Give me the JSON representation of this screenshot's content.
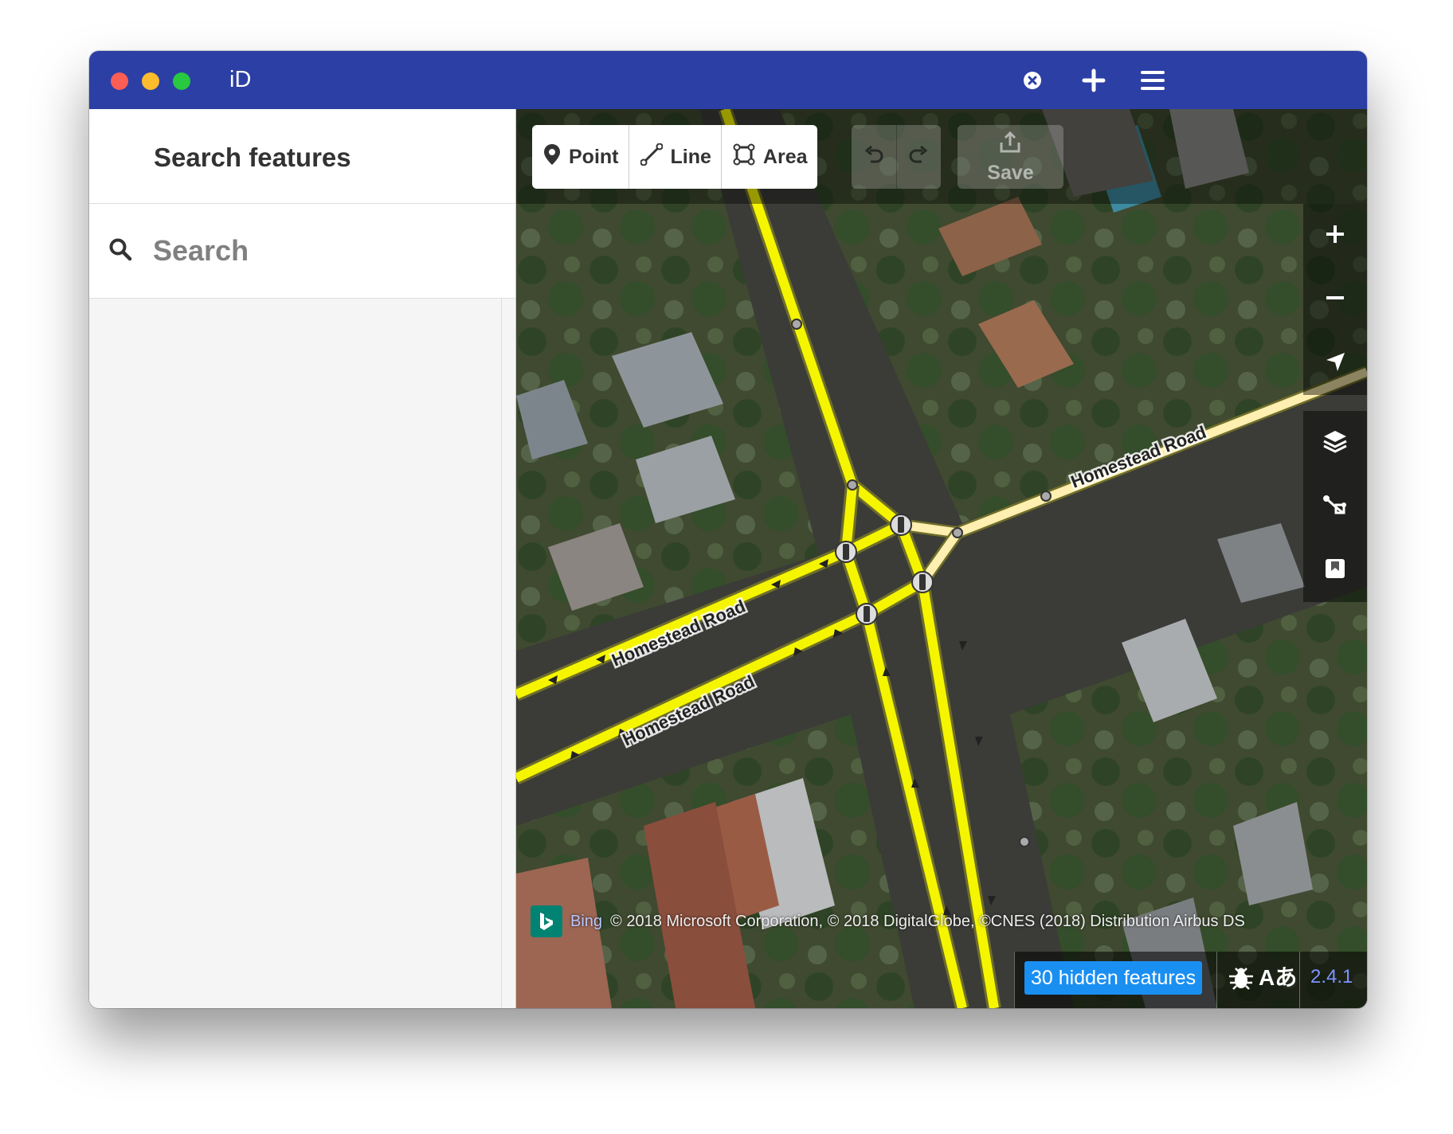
{
  "window": {
    "app_title": "iD"
  },
  "sidebar": {
    "header_title": "Search features",
    "search": {
      "placeholder": "Search",
      "value": ""
    }
  },
  "toolbar": {
    "modes": [
      {
        "label": "Point",
        "icon": "marker-icon"
      },
      {
        "label": "Line",
        "icon": "line-icon"
      },
      {
        "label": "Area",
        "icon": "area-icon"
      }
    ],
    "undo_icon": "undo-icon",
    "redo_icon": "redo-icon",
    "save_label": "Save"
  },
  "map": {
    "road_labels": [
      "Homestead Road",
      "Homestead Road",
      "Homestead Road"
    ],
    "attribution": {
      "provider": "Bing",
      "text": "© 2018 Microsoft Corporation, © 2018 DigitalGlobe, ©CNES (2018) Distribution Airbus DS"
    },
    "controls": [
      "zoom-in-icon",
      "zoom-out-icon",
      "geolocate-icon",
      "layers-icon",
      "map-data-icon",
      "issues-icon"
    ],
    "colors": {
      "road": "#f5f500",
      "road_casing": "#6e6e2a",
      "residential": "#ffefb0"
    }
  },
  "footer": {
    "hidden_features": "30 hidden features",
    "version": "2.4.1"
  },
  "theme": {
    "titlebar": "#2c3fa5",
    "badge": "#1a8ff2",
    "version_color": "#7c94ff"
  }
}
